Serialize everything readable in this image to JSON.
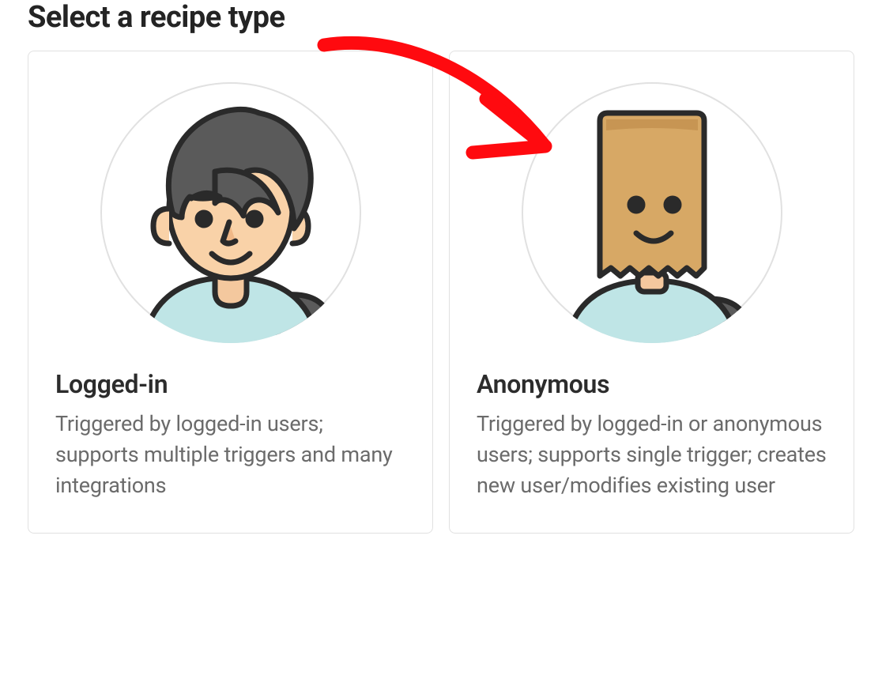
{
  "heading": "Select a recipe type",
  "cards": [
    {
      "title": "Logged-in",
      "description": "Triggered by logged-in users; supports multiple triggers and many integrations"
    },
    {
      "title": "Anonymous",
      "description": "Triggered by logged-in or anonymous users; supports single trigger; creates new user/modifies existing user"
    }
  ],
  "annotation_color": "#ff0a0f"
}
